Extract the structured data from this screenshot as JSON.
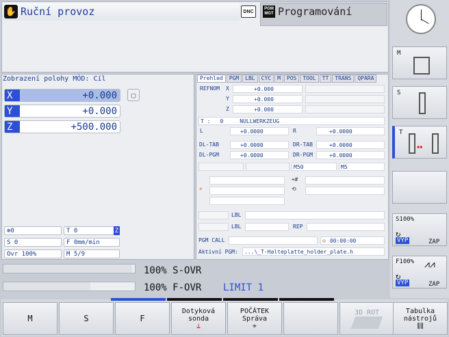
{
  "header": {
    "mode_left": "Ruční provoz",
    "dnc": "DNC",
    "pgm_icon": "PGM MGT",
    "mode_right": "Programování"
  },
  "position": {
    "title": "Zobrazení polohy",
    "mode_label": "MÓD: Cíl",
    "axes": [
      {
        "axis": "X",
        "value": "+0.000"
      },
      {
        "axis": "Y",
        "value": "+0.000"
      },
      {
        "axis": "Z",
        "value": "+500.000"
      }
    ]
  },
  "status": {
    "spindle_icon_val": "0",
    "t": "T 0",
    "z": "Z",
    "s": "S 0",
    "f": "F 0mm/min",
    "ovr": "Ovr 100%",
    "m": "M 5/9"
  },
  "tabs": [
    "Prehled",
    "PGM",
    "LBL",
    "CYC",
    "M",
    "POS",
    "TOOL",
    "TT",
    "TRANS",
    "QPARA"
  ],
  "overview": {
    "refnom": "REFNOM",
    "axes": [
      {
        "a": "X",
        "v": "+0.000"
      },
      {
        "a": "Y",
        "v": "+0.000"
      },
      {
        "a": "Z",
        "v": "+0.000"
      }
    ],
    "t_label": "T :",
    "t_num": "0",
    "t_name": "NULLWERKZEUG",
    "l": "L",
    "l_val": "+0.0000",
    "r": "R",
    "r_val": "+0.0000",
    "dltab": "DL-TAB",
    "dltab_val": "+0.0000",
    "drtab": "DR-TAB",
    "drtab_val": "+0.0000",
    "dlpgm": "DL-PGM",
    "dlpgm_val": "+0.0000",
    "drpgm": "DR-PGM",
    "drpgm_val": "+0.0000",
    "m50": "M50",
    "m5": "M5",
    "lbl1": "LBL",
    "lbl2": "LBL",
    "rep": "REP",
    "pgm_call": "PGM CALL",
    "time": "00:00:00",
    "active_pgm": "Aktivní PGM:",
    "active_pgm_val": "...\\_T-Halteplatte_holder_plate.h"
  },
  "override": {
    "s_pct": "100%",
    "s_label": "S-OVR",
    "f_pct": "100%",
    "f_label": "F-OVR",
    "limit": "LIMIT 1",
    "s_level": 0.98,
    "f_level": 0.66
  },
  "softkeys": [
    "M",
    "S",
    "F",
    "Dotyková sonda",
    "POČÁTEK Správa",
    "",
    "3D ROT",
    "Tabulka nástrojů"
  ],
  "vertical": {
    "m": "M",
    "s": "S",
    "t": "T",
    "s100": "S100%",
    "f100": "F100%",
    "vyp": "VYP",
    "zap": "ZAP"
  }
}
